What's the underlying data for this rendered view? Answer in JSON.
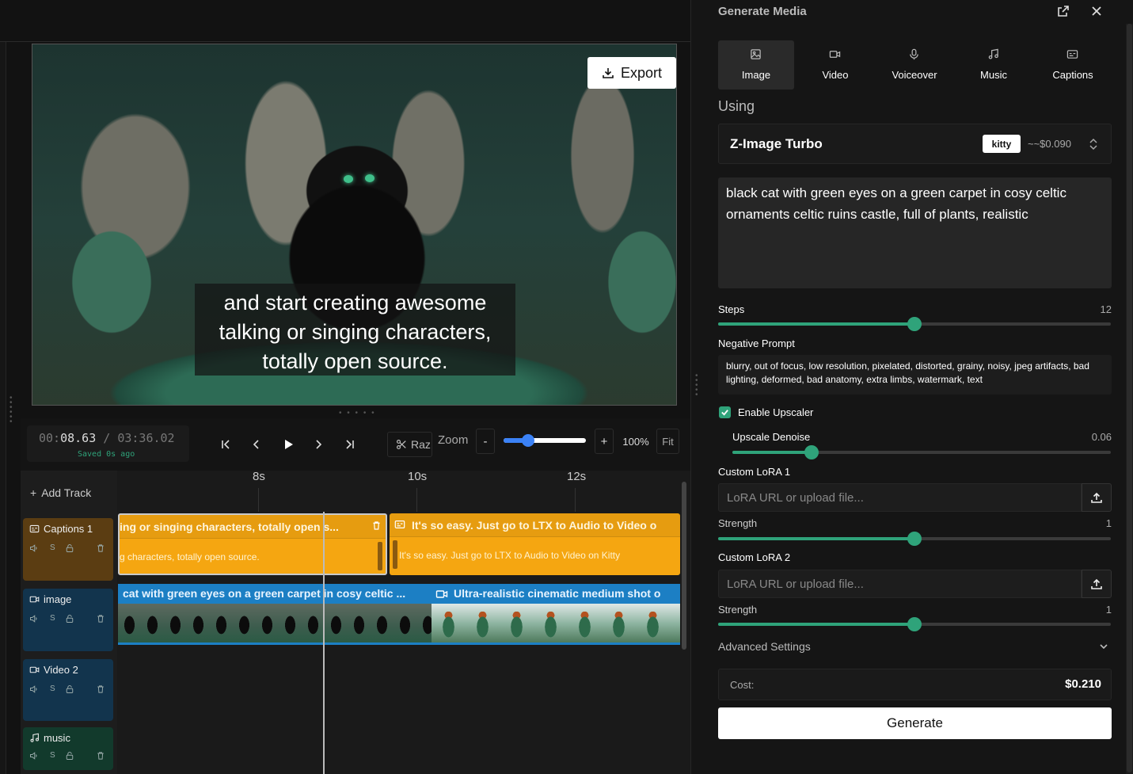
{
  "preview": {
    "export_label": "Export",
    "caption_lines": [
      "and start creating awesome",
      "talking or singing characters,",
      "totally open source."
    ]
  },
  "transport": {
    "time_current_a": "00:",
    "time_current_b": "08.63",
    "time_sep": " / ",
    "time_total": "03:36.02",
    "saved": "Saved 0s ago",
    "raz": "Raz",
    "zoom_label": "Zoom",
    "zoom_minus": "-",
    "zoom_plus": "+",
    "zoom_pct": "100%",
    "fit": "Fit",
    "zoom_level": 0.3
  },
  "timeline": {
    "add_track": "Add Track",
    "ruler": [
      "8s",
      "10s",
      "12s"
    ],
    "tracks": [
      {
        "name": "Captions 1",
        "icon": "captions-icon",
        "color": "#5b3d12"
      },
      {
        "name": "image",
        "icon": "video-icon",
        "color": "#12344d"
      },
      {
        "name": "Video 2",
        "icon": "video-icon",
        "color": "#12344d"
      },
      {
        "name": "music",
        "icon": "music-icon",
        "color": "#123a2c"
      }
    ],
    "solo_label": "S",
    "caption_clips": [
      {
        "title": "ing or singing characters, totally open s...",
        "sub": "g characters, totally open source."
      },
      {
        "title": "It's so easy. Just go to LTX to Audio to Video o",
        "sub": "It's so easy. Just go to LTX to Audio to Video on Kitty"
      }
    ],
    "image_clips": [
      {
        "title": "cat with green eyes on a green carpet in cosy celtic ..."
      },
      {
        "title": "Ultra-realistic cinematic medium shot o"
      }
    ]
  },
  "panel": {
    "title": "Generate Media",
    "tabs": [
      {
        "label": "Image",
        "icon": "image-icon"
      },
      {
        "label": "Video",
        "icon": "video-icon"
      },
      {
        "label": "Voiceover",
        "icon": "mic-icon"
      },
      {
        "label": "Music",
        "icon": "music-icon"
      },
      {
        "label": "Captions",
        "icon": "captions-icon"
      }
    ],
    "using_label": "Using",
    "model": "Z-Image Turbo",
    "model_badge": "kitty",
    "model_price": "~~$0.090",
    "prompt": "black cat with green eyes on a green carpet in cosy celtic ornaments celtic ruins castle, full of plants, realistic",
    "steps_label": "Steps",
    "steps_value": "12",
    "steps_level": 0.5,
    "negative_label": "Negative Prompt",
    "negative": "blurry, out of focus, low resolution, pixelated, distorted, grainy, noisy, jpeg artifacts, bad lighting, deformed, bad anatomy, extra limbs, watermark, text",
    "upscaler_label": "Enable Upscaler",
    "upscaler_checked": true,
    "denoise_label": "Upscale Denoise",
    "denoise_value": "0.06",
    "denoise_level": 0.21,
    "lora1_label": "Custom LoRA 1",
    "lora1_placeholder": "LoRA URL or upload file...",
    "strength1_label": "Strength",
    "strength1_value": "1",
    "strength1_level": 0.5,
    "lora2_label": "Custom LoRA 2",
    "lora2_placeholder": "LoRA URL or upload file...",
    "strength2_label": "Strength",
    "strength2_value": "1",
    "strength2_level": 0.5,
    "advanced_label": "Advanced Settings",
    "cost_label": "Cost:",
    "cost_value": "$0.210",
    "generate_label": "Generate"
  }
}
